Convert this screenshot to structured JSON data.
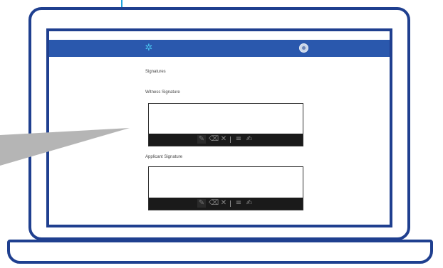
{
  "app": {
    "header": {
      "settings_icon": "gear-icon",
      "profile_icon": "avatar"
    }
  },
  "form": {
    "signatures_heading": "Signatures",
    "witness": {
      "label": "Witness Signature"
    },
    "applicant": {
      "label": "Applicant Signature"
    }
  },
  "toolbar": {
    "tools": [
      "pen-tool",
      "eraser-tool",
      "clear-tool",
      "lines-tool",
      "edit-tool"
    ]
  },
  "colors": {
    "frame": "#1f3f8f",
    "appbar": "#2a58ad",
    "gear": "#49c2ee",
    "toolbar": "#1a1a1a",
    "pointer": "#b5b5b5",
    "cable": "#1ea3dd"
  }
}
